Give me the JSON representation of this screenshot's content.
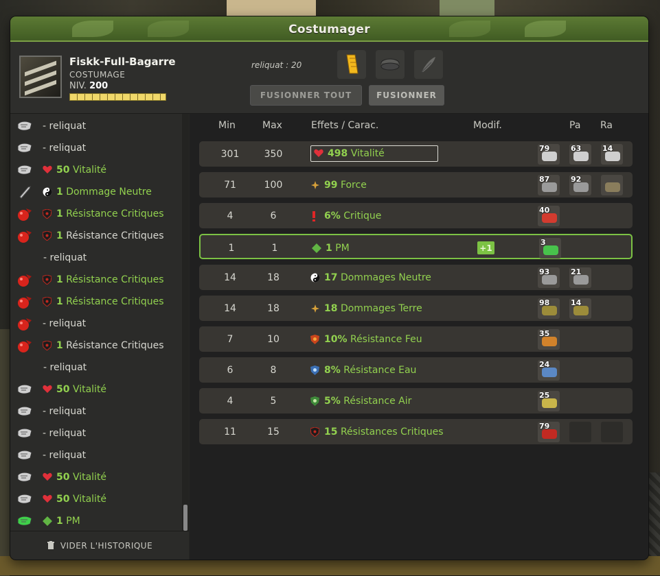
{
  "window": {
    "title": "Costumager"
  },
  "character": {
    "name": "Fiskk-Full-Bagarre",
    "subtitle": "COSTUMAGE",
    "level_label": "NIV.",
    "level": "200"
  },
  "reliquat": "reliquat : 20",
  "slots": [
    "golden-feather-icon",
    "disc-icon",
    "feather-icon"
  ],
  "buttons": {
    "fuse_all": "FUSIONNER TOUT",
    "fuse": "FUSIONNER"
  },
  "history": {
    "rows": [
      {
        "icon": "rune-icon",
        "value": "",
        "text": "- reliquat",
        "green": false
      },
      {
        "icon": "rune-icon",
        "value": "",
        "text": "- reliquat",
        "green": false
      },
      {
        "icon": "rune-icon",
        "effect_icon": "heart-icon",
        "value": "50",
        "text": "Vitalité",
        "green": true
      },
      {
        "icon": "sword-rune-icon",
        "effect_icon": "yinyang-icon",
        "value": "1",
        "text": "Dommage Neutre",
        "green": true
      },
      {
        "icon": "red-rune-icon",
        "effect_icon": "shield-icon",
        "value": "1",
        "text": "Résistance Critiques",
        "green": true
      },
      {
        "icon": "red-rune-icon",
        "effect_icon": "shield-icon",
        "value": "1",
        "text": "Résistance Critiques",
        "green": false
      },
      {
        "icon": "",
        "value": "",
        "text": "- reliquat",
        "green": false,
        "sub": true
      },
      {
        "icon": "red-rune-icon",
        "effect_icon": "shield-icon",
        "value": "1",
        "text": "Résistance Critiques",
        "green": true
      },
      {
        "icon": "red-rune-icon",
        "effect_icon": "shield-icon",
        "value": "1",
        "text": "Résistance Critiques",
        "green": true
      },
      {
        "icon": "red-rune-icon",
        "value": "",
        "text": "- reliquat",
        "green": false
      },
      {
        "icon": "red-rune-icon",
        "effect_icon": "shield-icon",
        "value": "1",
        "text": "Résistance Critiques",
        "green": false
      },
      {
        "icon": "",
        "value": "",
        "text": "- reliquat",
        "green": false,
        "sub": true
      },
      {
        "icon": "rune-icon",
        "effect_icon": "heart-icon",
        "value": "50",
        "text": "Vitalité",
        "green": true
      },
      {
        "icon": "rune-icon",
        "value": "",
        "text": "- reliquat",
        "green": false
      },
      {
        "icon": "rune-icon",
        "value": "",
        "text": "- reliquat",
        "green": false
      },
      {
        "icon": "rune-icon",
        "value": "",
        "text": "- reliquat",
        "green": false
      },
      {
        "icon": "rune-icon",
        "effect_icon": "heart-icon",
        "value": "50",
        "text": "Vitalité",
        "green": true
      },
      {
        "icon": "rune-icon",
        "effect_icon": "heart-icon",
        "value": "50",
        "text": "Vitalité",
        "green": true
      },
      {
        "icon": "green-rune-icon",
        "effect_icon": "diamond-icon",
        "value": "1",
        "text": "PM",
        "green": true
      }
    ],
    "clear_label": "VIDER L'HISTORIQUE"
  },
  "table": {
    "headers": {
      "min": "Min",
      "max": "Max",
      "effects": "Effets / Carac.",
      "modif": "Modif.",
      "pa": "Pa",
      "ra": "Ra"
    },
    "rows": [
      {
        "min": "301",
        "max": "350",
        "icon": "heart-icon",
        "value": "498",
        "label": "Vitalité",
        "boxed": true,
        "modif": "",
        "runes": [
          {
            "n": "79",
            "c": "#cfcfcf"
          },
          {
            "n": "63",
            "c": "#cfcfcf"
          },
          {
            "n": "14",
            "c": "#cfcfcf"
          }
        ]
      },
      {
        "min": "71",
        "max": "100",
        "icon": "star-icon",
        "value": "99",
        "label": "Force",
        "modif": "",
        "runes": [
          {
            "n": "87",
            "c": "#9a9a9a"
          },
          {
            "n": "92",
            "c": "#9a9a9a"
          },
          {
            "n": "",
            "c": "#8a7d5c"
          }
        ]
      },
      {
        "min": "4",
        "max": "6",
        "icon": "exclaim-icon",
        "value": "6%",
        "label": "Critique",
        "modif": "",
        "runes": [
          {
            "n": "40",
            "c": "#d33b2f"
          }
        ]
      },
      {
        "min": "1",
        "max": "1",
        "icon": "diamond-icon",
        "value": "1",
        "label": "PM",
        "modif": "+1",
        "highlight": true,
        "runes": [
          {
            "n": "3",
            "c": "#48c34c"
          }
        ]
      },
      {
        "min": "14",
        "max": "18",
        "icon": "yinyang-icon",
        "value": "17",
        "label": "Dommages Neutre",
        "modif": "",
        "runes": [
          {
            "n": "93",
            "c": "#9a9a9a"
          },
          {
            "n": "21",
            "c": "#9a9a9a"
          }
        ]
      },
      {
        "min": "14",
        "max": "18",
        "icon": "star-icon",
        "value": "18",
        "label": "Dommages Terre",
        "modif": "",
        "runes": [
          {
            "n": "98",
            "c": "#9c8c3a"
          },
          {
            "n": "14",
            "c": "#9c8c3a"
          }
        ]
      },
      {
        "min": "7",
        "max": "10",
        "icon": "fire-shield-icon",
        "value": "10%",
        "label": "Résistance Feu",
        "modif": "",
        "runes": [
          {
            "n": "35",
            "c": "#d1822b"
          }
        ]
      },
      {
        "min": "6",
        "max": "8",
        "icon": "water-shield-icon",
        "value": "8%",
        "label": "Résistance Eau",
        "modif": "",
        "runes": [
          {
            "n": "24",
            "c": "#5b88c4"
          }
        ]
      },
      {
        "min": "4",
        "max": "5",
        "icon": "air-shield-icon",
        "value": "5%",
        "label": "Résistance Air",
        "modif": "",
        "runes": [
          {
            "n": "25",
            "c": "#c9b54a"
          }
        ]
      },
      {
        "min": "11",
        "max": "15",
        "icon": "crit-shield-icon",
        "value": "15",
        "label": "Résistances Critiques",
        "modif": "",
        "runes": [
          {
            "n": "79",
            "c": "#c22a22"
          },
          {
            "n": "",
            "c": "",
            "empty": true
          },
          {
            "n": "",
            "c": "",
            "empty": true
          }
        ]
      }
    ]
  }
}
